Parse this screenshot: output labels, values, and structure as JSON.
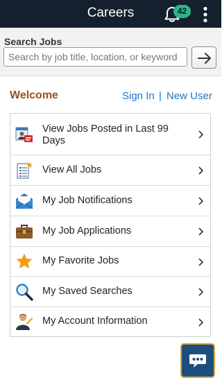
{
  "header": {
    "title": "Careers",
    "notification_count": "42"
  },
  "search": {
    "label": "Search Jobs",
    "placeholder": "Search by job title, location, or keyword"
  },
  "welcome": {
    "heading": "Welcome",
    "sign_in": "Sign In",
    "separator": "|",
    "new_user": "New User"
  },
  "menu": [
    {
      "label": "View Jobs Posted in Last 99 Days",
      "icon": "calendar-jobs-icon"
    },
    {
      "label": "View All Jobs",
      "icon": "document-list-icon"
    },
    {
      "label": "My Job Notifications",
      "icon": "envelope-icon"
    },
    {
      "label": "My Job Applications",
      "icon": "briefcase-icon"
    },
    {
      "label": "My Favorite Jobs",
      "icon": "star-icon"
    },
    {
      "label": "My Saved Searches",
      "icon": "magnifier-icon"
    },
    {
      "label": "My Account Information",
      "icon": "person-icon"
    }
  ],
  "colors": {
    "header_bg": "#14202d",
    "badge": "#2bb58c",
    "welcome": "#9a4e1c",
    "link": "#1f74c4",
    "chat_bg": "#1d4f7e"
  }
}
